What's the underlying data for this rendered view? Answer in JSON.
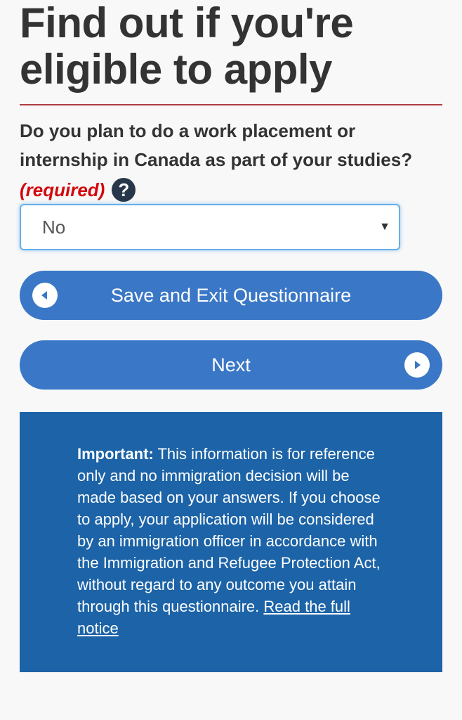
{
  "heading": {
    "title": "Find out if you're eligible to apply"
  },
  "question": {
    "text": "Do you plan to do a work placement or internship in Canada as part of your studies?",
    "required_label": "(required)",
    "help_icon": "question-mark-icon",
    "help_glyph": "?"
  },
  "answer_select": {
    "selected": "No",
    "arrow_glyph": "▼"
  },
  "buttons": {
    "save_exit_label": "Save and Exit Questionnaire",
    "save_exit_icon": "circle-arrow-left-icon",
    "next_label": "Next",
    "next_icon": "circle-arrow-right-icon"
  },
  "notice": {
    "strong": "Important:",
    "body": " This information is for reference only and no immigration decision will be made based on your answers. If you choose to apply, your application will be considered by an immigration officer in accordance with the Immigration and Refugee Protection Act, without regard to any outcome you attain through this questionnaire. ",
    "link_text": "Read the full notice"
  },
  "colors": {
    "accent_rule": "#af3c43",
    "required": "#d3080c",
    "button_blue": "#3a77c6",
    "notice_blue": "#1c63a7",
    "help_icon_bg": "#26374a"
  }
}
